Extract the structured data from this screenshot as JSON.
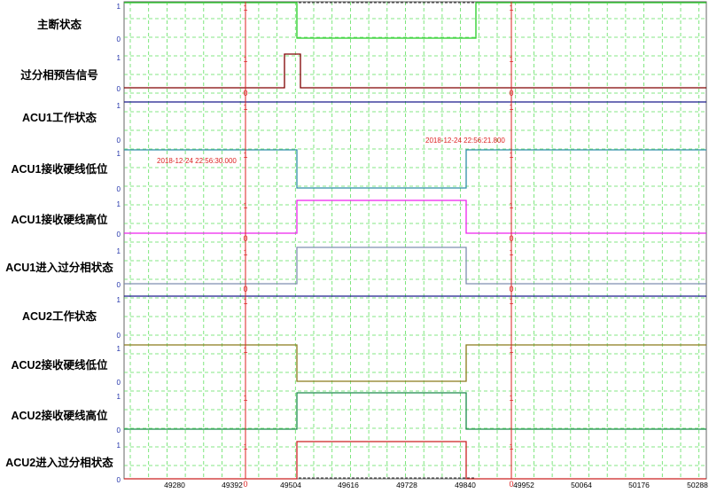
{
  "chart_data": {
    "type": "line",
    "title": "",
    "xlabel": "",
    "ylabel": "",
    "x_ticks": [
      "49280",
      "49392",
      "49504",
      "49616",
      "49728",
      "49840",
      "49952",
      "50064",
      "50176",
      "50288"
    ],
    "cursor_values": [
      "1",
      "0"
    ],
    "timestamps": [
      {
        "text": "2018-12-24 22:56:30.000"
      },
      {
        "text": "2018-12-24 22:56:21.800"
      }
    ],
    "series": [
      {
        "name": "主断状态",
        "color": "#22cc22",
        "y_top": "1",
        "y_bottom": "0"
      },
      {
        "name": "过分相预告信号",
        "color": "#800000",
        "y_top": "1",
        "y_bottom": "0"
      },
      {
        "name": "ACU1工作状态",
        "color": "#1a1a8c",
        "y_top": "1",
        "y_bottom": "0"
      },
      {
        "name": "ACU1接收硬线低位",
        "color": "#2f8fa8",
        "y_top": "1",
        "y_bottom": "0"
      },
      {
        "name": "ACU1接收硬线高位",
        "color": "#ee22ee",
        "y_top": "1",
        "y_bottom": "0"
      },
      {
        "name": "ACU1进入过分相状态",
        "color": "#7f8fb0",
        "y_top": "1",
        "y_bottom": "0"
      },
      {
        "name": "ACU2工作状态",
        "color": "#1a1a8c",
        "y_top": "1",
        "y_bottom": "0"
      },
      {
        "name": "ACU2接收硬线低位",
        "color": "#8a7a1a",
        "y_top": "1",
        "y_bottom": "0"
      },
      {
        "name": "ACU2接收硬线高位",
        "color": "#1a8a4a",
        "y_top": "1",
        "y_bottom": "0"
      },
      {
        "name": "ACU2进入过分相状态",
        "color": "#cc2222",
        "y_top": "1",
        "y_bottom": "0"
      }
    ]
  }
}
